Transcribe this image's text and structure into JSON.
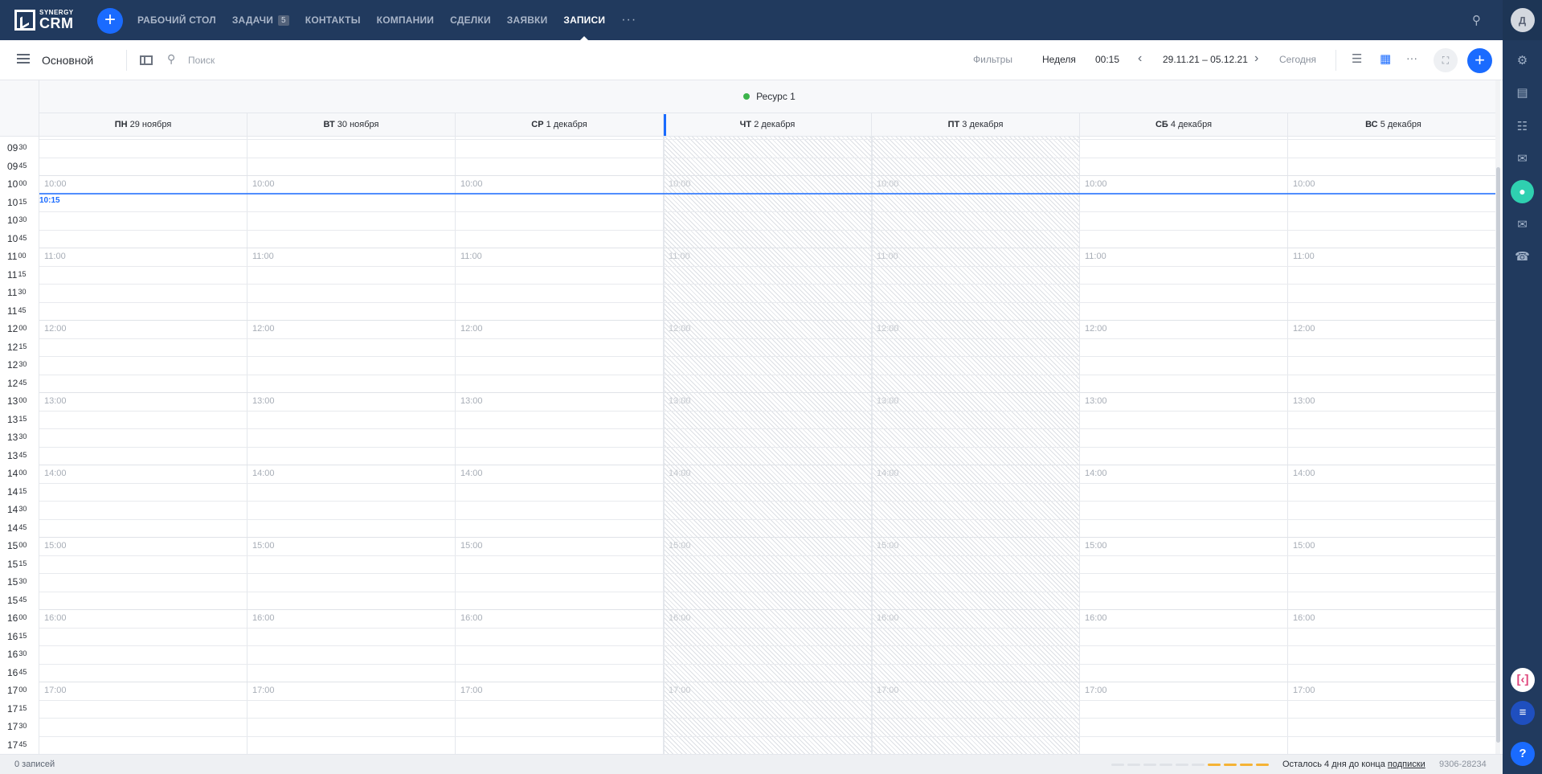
{
  "app": {
    "logo_small": "SYNERGY",
    "logo_big": "CRM"
  },
  "topnav": {
    "items": [
      {
        "label": "РАБОЧИЙ СТОЛ"
      },
      {
        "label": "ЗАДАЧИ",
        "badge": "5"
      },
      {
        "label": "КОНТАКТЫ"
      },
      {
        "label": "КОМПАНИИ"
      },
      {
        "label": "СДЕЛКИ"
      },
      {
        "label": "ЗАЯВКИ"
      },
      {
        "label": "ЗАПИСИ",
        "active": true
      }
    ],
    "more": "···"
  },
  "user": {
    "initial": "Д"
  },
  "toolbar": {
    "title": "Основной",
    "search_placeholder": "Поиск",
    "filters": "Фильтры",
    "view": "Неделя",
    "step": "00:15",
    "range": "29.11.21 – 05.12.21",
    "today": "Сегодня",
    "more": "···"
  },
  "calendar": {
    "resource": "Ресурс 1",
    "days": [
      {
        "abbr": "ПН",
        "date": "29 ноября"
      },
      {
        "abbr": "ВТ",
        "date": "30 ноября"
      },
      {
        "abbr": "СР",
        "date": "1 декабря"
      },
      {
        "abbr": "ЧТ",
        "date": "2 декабря"
      },
      {
        "abbr": "ПТ",
        "date": "3 декабря"
      },
      {
        "abbr": "СБ",
        "date": "4 декабря"
      },
      {
        "abbr": "ВС",
        "date": "5 декабря"
      }
    ],
    "current_time": "10:15",
    "slots": [
      {
        "h": "09",
        "m": "30"
      },
      {
        "h": "09",
        "m": "45"
      },
      {
        "h": "10",
        "m": "00",
        "label": "10:00"
      },
      {
        "h": "10",
        "m": "15"
      },
      {
        "h": "10",
        "m": "30"
      },
      {
        "h": "10",
        "m": "45"
      },
      {
        "h": "11",
        "m": "00",
        "label": "11:00"
      },
      {
        "h": "11",
        "m": "15"
      },
      {
        "h": "11",
        "m": "30"
      },
      {
        "h": "11",
        "m": "45"
      },
      {
        "h": "12",
        "m": "00",
        "label": "12:00"
      },
      {
        "h": "12",
        "m": "15"
      },
      {
        "h": "12",
        "m": "30"
      },
      {
        "h": "12",
        "m": "45"
      },
      {
        "h": "13",
        "m": "00",
        "label": "13:00"
      },
      {
        "h": "13",
        "m": "15"
      },
      {
        "h": "13",
        "m": "30"
      },
      {
        "h": "13",
        "m": "45"
      },
      {
        "h": "14",
        "m": "00",
        "label": "14:00"
      },
      {
        "h": "14",
        "m": "15"
      },
      {
        "h": "14",
        "m": "30"
      },
      {
        "h": "14",
        "m": "45"
      },
      {
        "h": "15",
        "m": "00",
        "label": "15:00"
      },
      {
        "h": "15",
        "m": "15"
      },
      {
        "h": "15",
        "m": "30"
      },
      {
        "h": "15",
        "m": "45"
      },
      {
        "h": "16",
        "m": "00",
        "label": "16:00"
      },
      {
        "h": "16",
        "m": "15"
      },
      {
        "h": "16",
        "m": "30"
      },
      {
        "h": "16",
        "m": "45"
      },
      {
        "h": "17",
        "m": "00",
        "label": "17:00"
      },
      {
        "h": "17",
        "m": "15"
      },
      {
        "h": "17",
        "m": "30"
      },
      {
        "h": "17",
        "m": "45"
      }
    ]
  },
  "footer": {
    "count": "0 записей",
    "remain_text": "Осталось 4 дня до конца ",
    "remain_link": "подписки",
    "account_id": "9306-28234"
  },
  "colors": {
    "nav_bg": "#213a5e",
    "accent": "#1a6bff",
    "resource_dot": "#3cb44b",
    "bell": "#2fd0b0",
    "dash_used": "#f5b335",
    "dash_empty": "#dfe2e7"
  }
}
